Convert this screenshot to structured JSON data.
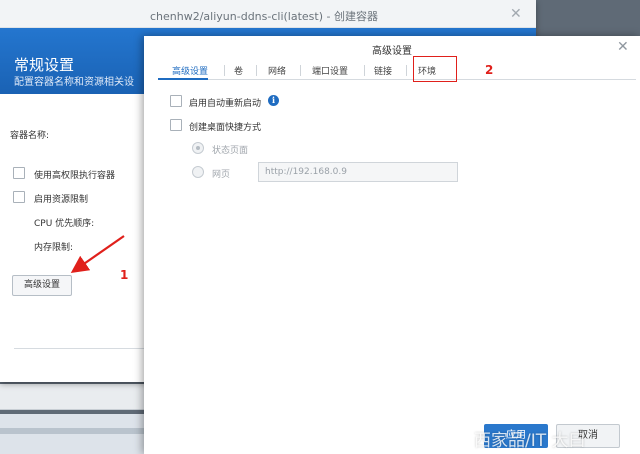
{
  "back_dialog": {
    "title": "chenhw2/aliyun-ddns-cli(latest) - 创建容器",
    "banner_title": "常规设置",
    "banner_subtitle": "配置容器名称和资源相关设",
    "container_name_label": "容器名称:",
    "privileged_label": "使用高权限执行容器",
    "resource_limit_label": "启用资源限制",
    "cpu_label": "CPU 优先顺序:",
    "memory_label": "内存限制:",
    "advanced_button": "高级设置"
  },
  "front_dialog": {
    "title": "高级设置",
    "tabs": [
      {
        "label": "高级设置"
      },
      {
        "label": "卷"
      },
      {
        "label": "网络"
      },
      {
        "label": "端口设置"
      },
      {
        "label": "链接"
      },
      {
        "label": "环境"
      }
    ],
    "active_tab": "高级设置",
    "auto_restart_label": "启用自动重新启动",
    "info_icon_glyph": "i",
    "desktop_shortcut_label": "创建桌面快捷方式",
    "status_page_label": "状态页面",
    "webpage_label": "网页",
    "url_value": "http://192.168.0.9",
    "apply_button": "应用",
    "cancel_button": "取消"
  },
  "watermark": "西家品/IT 大曰",
  "annotations": {
    "step1": "1",
    "step2": "2",
    "color": "#e0201b"
  },
  "colors": {
    "accent": "#1f6cc1",
    "banner": "#1f6cc1"
  }
}
